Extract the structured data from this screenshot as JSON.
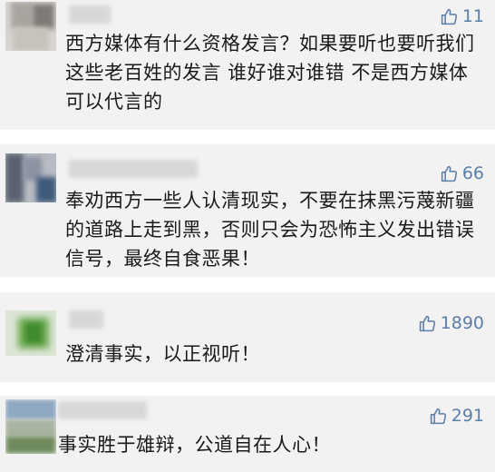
{
  "comments": [
    {
      "likes": "11",
      "text": "西方媒体有什么资格发言？如果要听也要听我们这些老百姓的发言 谁好谁对谁错 不是西方媒体可以代言的"
    },
    {
      "likes": "66",
      "text": "奉劝西方一些人认清现实，不要在抹黑污蔑新疆的道路上走到黑，否则只会为恐怖主义发出错误信号，最终自食恶果！"
    },
    {
      "likes": "1890",
      "text": "澄清事实，以正视听！"
    },
    {
      "likes": "291",
      "text": "事实胜于雄辩，公道自在人心！"
    }
  ],
  "icons": {
    "like": "thumbs-up-icon",
    "avatar": "blurred-avatar"
  },
  "colors": {
    "card_bg": "#f2f2f2",
    "like": "#5b7fa8",
    "text": "#1a1a1a"
  }
}
